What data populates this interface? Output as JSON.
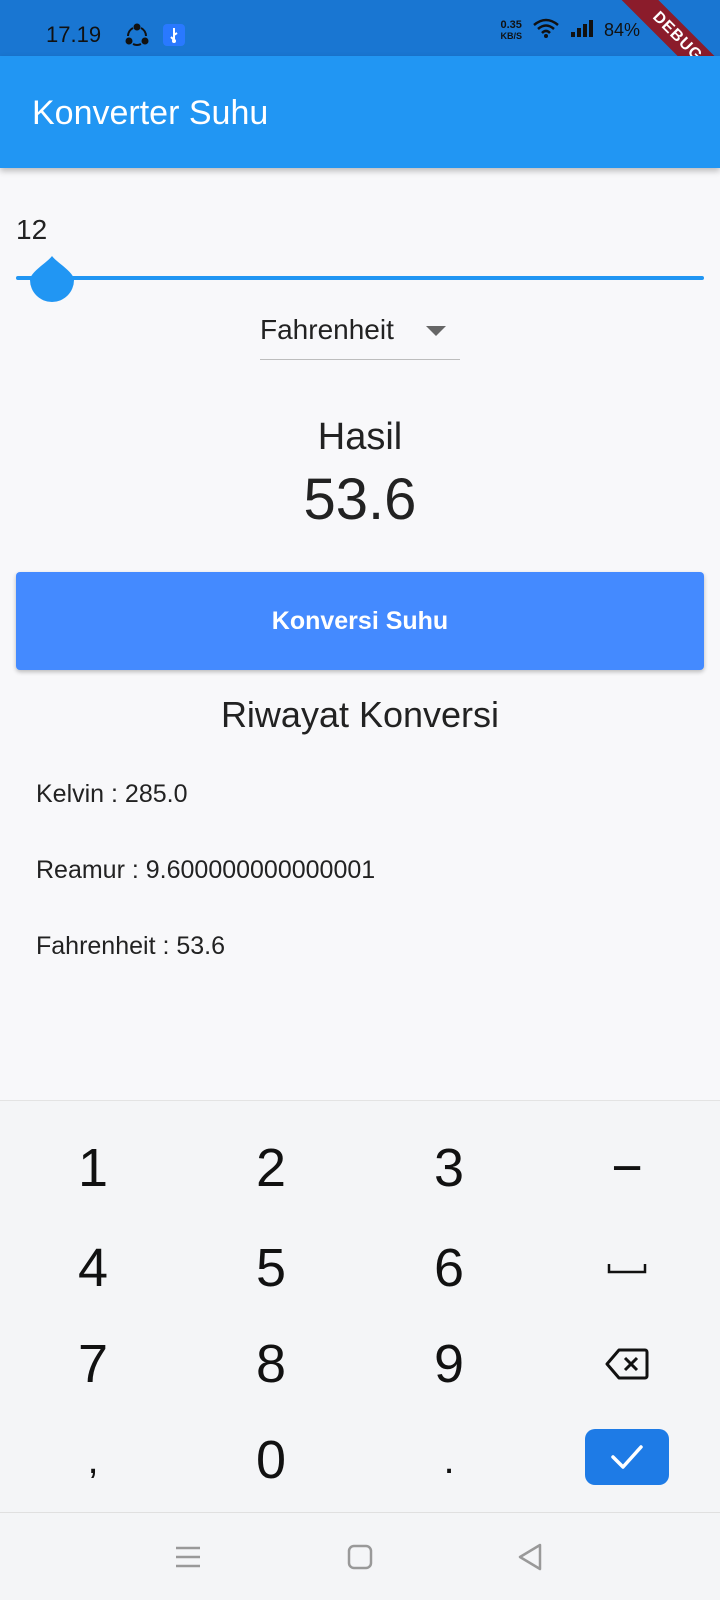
{
  "status_bar": {
    "time": "17.19",
    "net_speed_value": "0.35",
    "net_speed_unit": "KB/S",
    "battery": "84%",
    "icons": [
      "sync-icon",
      "usb-icon",
      "wifi-icon",
      "signal-icon"
    ]
  },
  "debug_banner": "DEBUG",
  "app_bar": {
    "title": "Konverter Suhu"
  },
  "slider": {
    "value_label": "12",
    "value": 12
  },
  "dropdown": {
    "selected": "Fahrenheit"
  },
  "result": {
    "label": "Hasil",
    "value": "53.6"
  },
  "convert_button": {
    "label": "Konversi Suhu"
  },
  "history": {
    "title": "Riwayat Konversi",
    "items": [
      "Kelvin : 285.0",
      "Reamur : 9.600000000000001",
      "Fahrenheit : 53.6"
    ]
  },
  "keyboard": {
    "keys": [
      "1",
      "2",
      "3",
      "−",
      "4",
      "5",
      "6",
      "␣",
      "7",
      "8",
      "9",
      "⌫",
      ",",
      "0",
      ".",
      "✓"
    ]
  },
  "colors": {
    "status_bar": "#1976d2",
    "app_bar": "#2196f3",
    "button": "#448aff",
    "done_key": "#1e7be6"
  }
}
